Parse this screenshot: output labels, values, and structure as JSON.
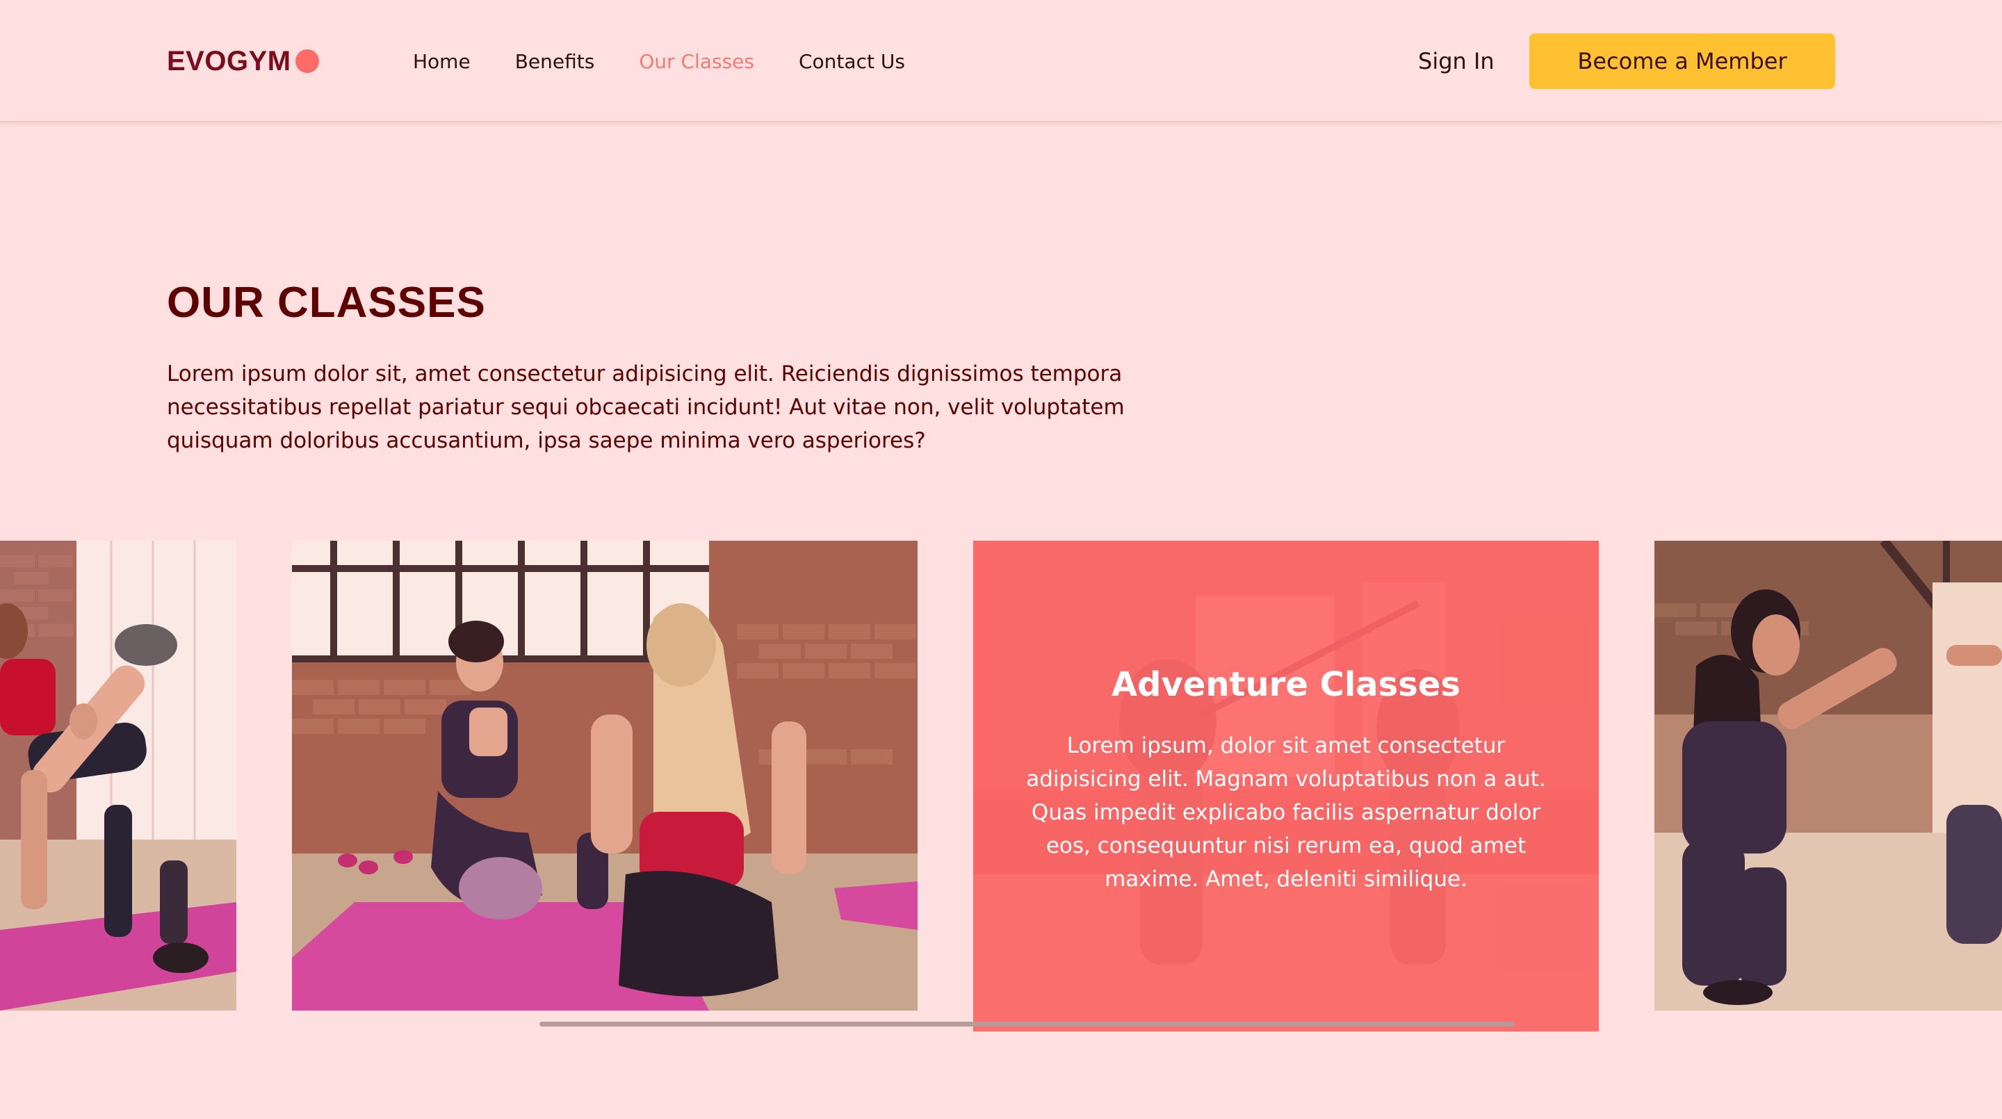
{
  "brand": {
    "name": "EVOGYM",
    "accent": "#ff6b66"
  },
  "nav": {
    "links": [
      "Home",
      "Benefits",
      "Our Classes",
      "Contact Us"
    ],
    "active": "Our Classes",
    "sign_in": "Sign In",
    "cta": "Become a Member"
  },
  "section": {
    "title": "OUR CLASSES",
    "description": "Lorem ipsum dolor sit, amet consectetur adipisicing elit. Reiciendis dignissimos tempora necessitatibus repellat pariatur sequi obcaecati incidunt! Aut vitae non, velit voluptatem quisquam doloribus accusantium, ipsa saepe minima vero asperiores?"
  },
  "carousel": {
    "hovered_card": {
      "title": "Adventure Classes",
      "description": "Lorem ipsum, dolor sit amet consectetur adipisicing elit. Magnam voluptatibus non a aut. Quas impedit explicabo facilis aspernatur dolor eos, consequuntur nisi rerum ea, quod amet maxime. Amet, deleniti similique."
    },
    "images": [
      "class-photo-kickback",
      "class-photo-mat-talk",
      "class-photo-adventure",
      "class-photo-high-five"
    ]
  },
  "colors": {
    "background": "#ffe0e0",
    "primary_dark": "#5e0000",
    "accent_red": "#ff6b66",
    "accent_yellow": "#ffc132"
  }
}
